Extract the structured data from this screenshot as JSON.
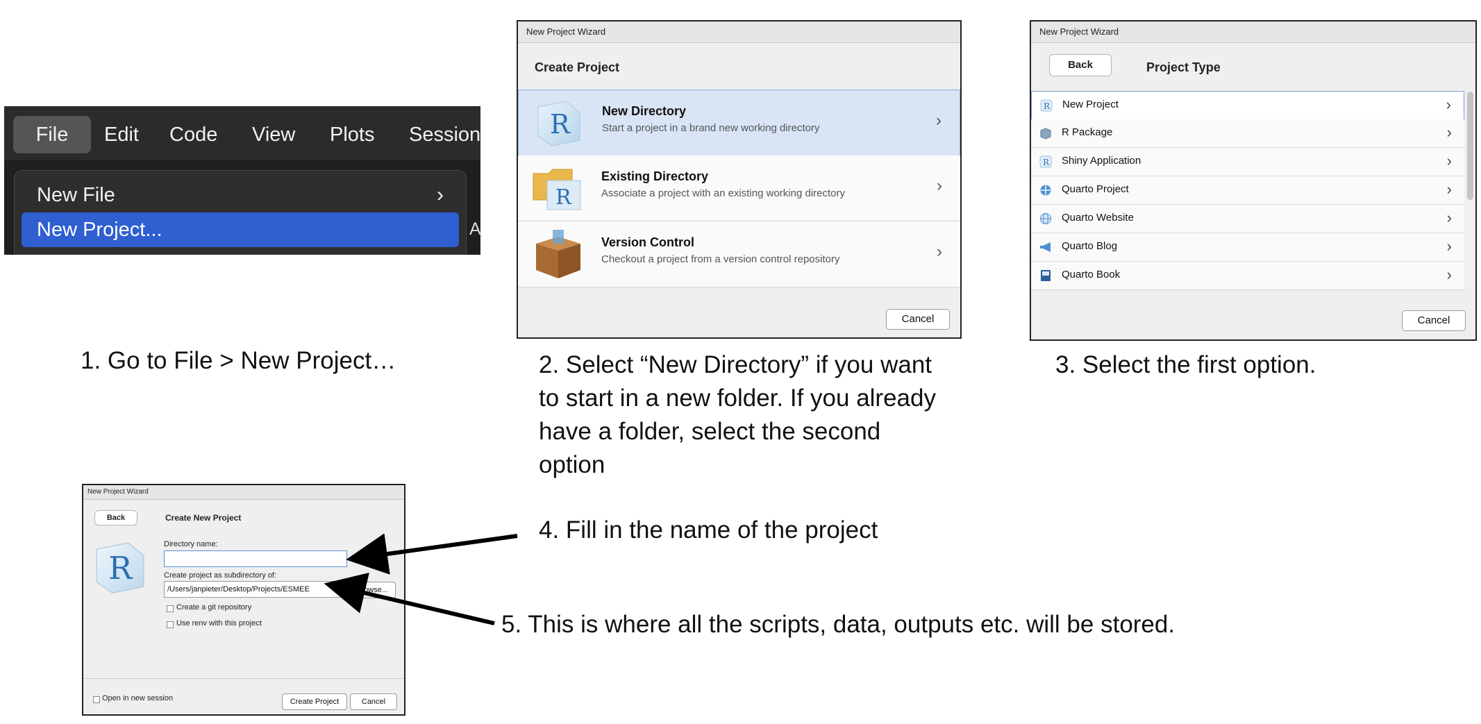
{
  "menu_panel": {
    "menu_items": [
      "File",
      "Edit",
      "Code",
      "View",
      "Plots",
      "Session"
    ],
    "dropdown_items": [
      {
        "label": "New File",
        "has_submenu": true
      },
      {
        "label": "New Project...",
        "highlighted": true
      }
    ],
    "cut_off_label": "A"
  },
  "wizard_choose": {
    "window_title": "New Project Wizard",
    "header": "Create Project",
    "options": [
      {
        "title": "New Directory",
        "subtitle": "Start a project in a brand new working directory",
        "icon": "r-logo-icon",
        "selected": true
      },
      {
        "title": "Existing Directory",
        "subtitle": "Associate a project with an existing working directory",
        "icon": "folder-r-icon"
      },
      {
        "title": "Version Control",
        "subtitle": "Checkout a project from a version control repository",
        "icon": "box-icon"
      }
    ],
    "cancel_label": "Cancel"
  },
  "wizard_type": {
    "window_title": "New Project Wizard",
    "back_label": "Back",
    "header": "Project Type",
    "types": [
      {
        "label": "New Project",
        "icon": "r-icon",
        "selected": true
      },
      {
        "label": "R Package",
        "icon": "package-icon"
      },
      {
        "label": "Shiny Application",
        "icon": "r-icon"
      },
      {
        "label": "Quarto Project",
        "icon": "quarto-icon"
      },
      {
        "label": "Quarto Website",
        "icon": "globe-icon"
      },
      {
        "label": "Quarto Blog",
        "icon": "megaphone-icon"
      },
      {
        "label": "Quarto Book",
        "icon": "book-icon"
      }
    ],
    "cancel_label": "Cancel"
  },
  "wizard_create": {
    "window_title": "New Project Wizard",
    "back_label": "Back",
    "header": "Create New Project",
    "directory_name_label": "Directory name:",
    "directory_name_value": "",
    "subdir_label": "Create project as subdirectory of:",
    "subdir_value": "/Users/janpieter/Desktop/Projects/ESMEE",
    "browse_label": "Browse...",
    "git_label": "Create a git repository",
    "renv_label": "Use renv with this project",
    "new_session_label": "Open in new session",
    "create_label": "Create Project",
    "cancel_label": "Cancel"
  },
  "captions": {
    "step1": "1. Go to File > New Project…",
    "step2": "2. Select “New Directory” if you want to start in a new folder. If you already have a folder, select the second option",
    "step3": "3. Select the first option.",
    "step4": "4. Fill in the name of the project",
    "step5": "5. This is where all the scripts, data, outputs etc. will be stored."
  },
  "colors": {
    "menu_highlight": "#2f5fd0",
    "selected_row": "#d9e4f5",
    "arrow": "#000000"
  }
}
